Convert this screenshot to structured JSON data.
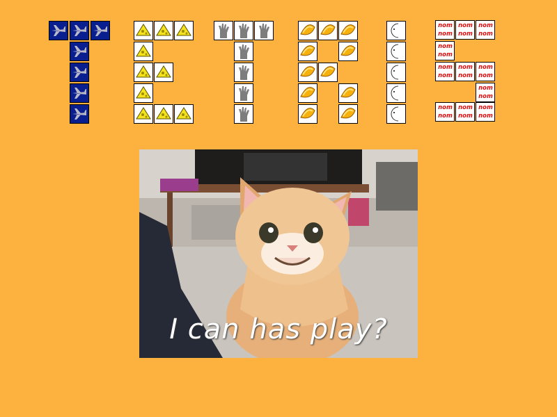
{
  "title": {
    "letters": [
      {
        "letter": "T",
        "tile": "plane-icon"
      },
      {
        "letter": "E",
        "tile": "cheese-icon"
      },
      {
        "letter": "T",
        "tile": "hand-icon"
      },
      {
        "letter": "R",
        "tile": "orange-slice-icon"
      },
      {
        "letter": "I",
        "tile": "moon-icon"
      },
      {
        "letter": "S",
        "tile": "nom-text"
      }
    ],
    "nom_word": "nom",
    "colors": {
      "background": "#FDB23F",
      "plane_tile": "#0a1f8f",
      "nom_text": "#e01010"
    }
  },
  "photo": {
    "subject": "smiling-kitten-icon",
    "caption": "I can has play?"
  }
}
